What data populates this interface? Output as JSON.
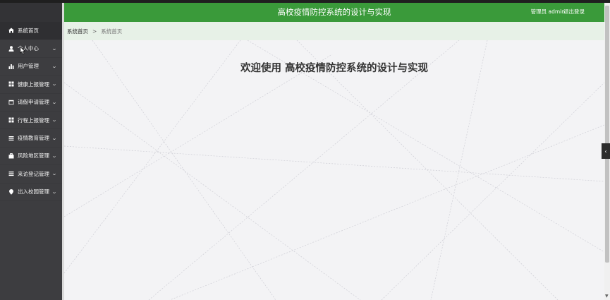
{
  "sidebar": {
    "items": [
      {
        "label": "系统首页",
        "icon": "home-icon",
        "has_chevron": false
      },
      {
        "label": "个人中心",
        "icon": "user-icon",
        "has_chevron": true
      },
      {
        "label": "用户管理",
        "icon": "bar-chart-icon",
        "has_chevron": true
      },
      {
        "label": "健康上报管理",
        "icon": "grid-icon",
        "has_chevron": true
      },
      {
        "label": "请假申请管理",
        "icon": "window-icon",
        "has_chevron": true
      },
      {
        "label": "行程上报管理",
        "icon": "grid-icon",
        "has_chevron": true
      },
      {
        "label": "疫情教育管理",
        "icon": "list-icon",
        "has_chevron": true
      },
      {
        "label": "风险地区管理",
        "icon": "briefcase-icon",
        "has_chevron": true
      },
      {
        "label": "来访登记管理",
        "icon": "list-icon",
        "has_chevron": true
      },
      {
        "label": "出入校园管理",
        "icon": "map-pin-icon",
        "has_chevron": true
      }
    ]
  },
  "header": {
    "title": "高校疫情防控系统的设计与实现",
    "user": "管理员 admin",
    "logout": "退出登录"
  },
  "breadcrumb": {
    "home": "系统首页",
    "separator": ">",
    "current": "系统首页"
  },
  "main": {
    "welcome": "欢迎使用 高校疫情防控系统的设计与实现"
  },
  "colors": {
    "header_bg": "#3a9a3a",
    "sidebar_bg": "#3d3d40",
    "breadcrumb_bg": "#e7f1e7",
    "main_bg": "#f3f3f5"
  }
}
